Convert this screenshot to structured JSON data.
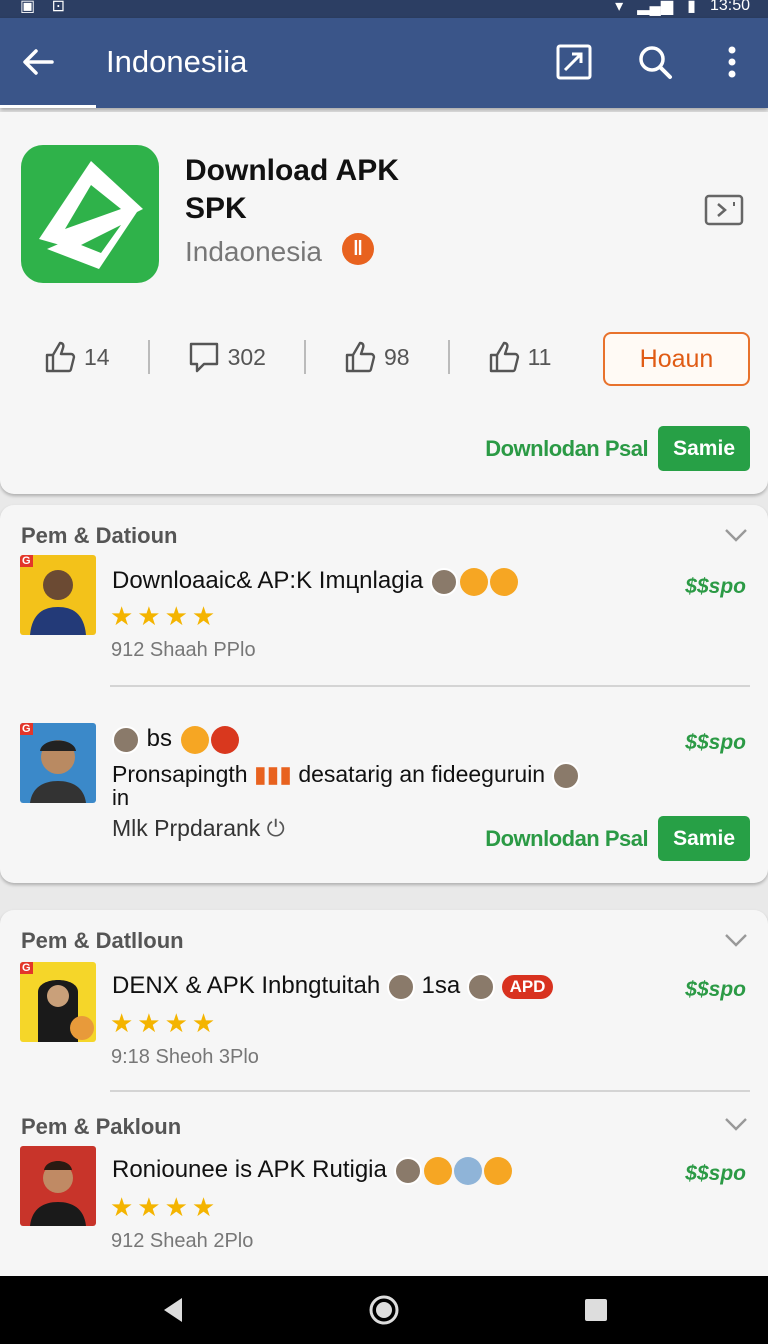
{
  "status": {
    "left_icons": "▣ ⊡",
    "signal": "▾",
    "time": "13:50"
  },
  "appbar": {
    "title": "Indonesiia"
  },
  "hero": {
    "title_line1": "Download APK",
    "title_line2": "SPK",
    "subtitle": "Indaonesia",
    "badge": "ǁ",
    "stats": [
      {
        "icon": "thumbs-up-icon",
        "value": "14"
      },
      {
        "icon": "comment-icon",
        "value": "302"
      },
      {
        "icon": "thumbs-up-icon",
        "value": "98"
      },
      {
        "icon": "thumbs-up-icon",
        "value": "11"
      }
    ],
    "action_button": "Hoaun",
    "download_text": "Downlodan Psal",
    "green_button": "Samie"
  },
  "section1": {
    "header": "Pem & Datioun",
    "rows": [
      {
        "title": "Downloaaic& AP:K Imцnlagia",
        "stars": "★★★★",
        "sub": "912 Shaah  PPlo",
        "price": "$$spo",
        "tag": "G"
      },
      {
        "title_a": "bs",
        "title_b": "Pronsapingth",
        "title_c": "desatarig an fideeguruin",
        "title_d": "in",
        "sub": "Mlk Prpdarank",
        "price": "$$spo",
        "tag": "G",
        "download_text": "Downlodan Psal",
        "green_button": "Samie"
      }
    ]
  },
  "section2": {
    "header": "Pem & Datlloun",
    "row": {
      "title": "DENX & APK Inbngtuitah",
      "extra": "1sa",
      "apd": "APD",
      "stars": "★★★★",
      "sub": "9:18 Sheoh  3Plo",
      "price": "$$spo",
      "tag": "G"
    }
  },
  "section3": {
    "header": "Pem & Pakloun",
    "row": {
      "title": "Roniounee is APK Rutigia",
      "stars": "★★★★",
      "sub": "912 Sheah  2Plo",
      "price": "$$spo"
    }
  },
  "colors": {
    "appbar": "#3a5589",
    "green": "#27a046",
    "orange": "#e8722c",
    "star": "#f4b400"
  }
}
